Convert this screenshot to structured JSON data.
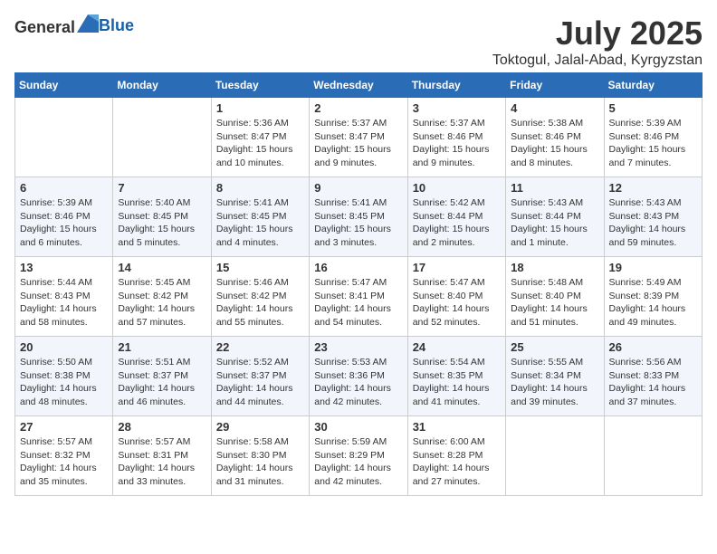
{
  "logo": {
    "general": "General",
    "blue": "Blue"
  },
  "header": {
    "month": "July 2025",
    "location": "Toktogul, Jalal-Abad, Kyrgyzstan"
  },
  "weekdays": [
    "Sunday",
    "Monday",
    "Tuesday",
    "Wednesday",
    "Thursday",
    "Friday",
    "Saturday"
  ],
  "weeks": [
    [
      {
        "day": null
      },
      {
        "day": null
      },
      {
        "day": 1,
        "sunrise": "Sunrise: 5:36 AM",
        "sunset": "Sunset: 8:47 PM",
        "daylight": "Daylight: 15 hours and 10 minutes."
      },
      {
        "day": 2,
        "sunrise": "Sunrise: 5:37 AM",
        "sunset": "Sunset: 8:47 PM",
        "daylight": "Daylight: 15 hours and 9 minutes."
      },
      {
        "day": 3,
        "sunrise": "Sunrise: 5:37 AM",
        "sunset": "Sunset: 8:46 PM",
        "daylight": "Daylight: 15 hours and 9 minutes."
      },
      {
        "day": 4,
        "sunrise": "Sunrise: 5:38 AM",
        "sunset": "Sunset: 8:46 PM",
        "daylight": "Daylight: 15 hours and 8 minutes."
      },
      {
        "day": 5,
        "sunrise": "Sunrise: 5:39 AM",
        "sunset": "Sunset: 8:46 PM",
        "daylight": "Daylight: 15 hours and 7 minutes."
      }
    ],
    [
      {
        "day": 6,
        "sunrise": "Sunrise: 5:39 AM",
        "sunset": "Sunset: 8:46 PM",
        "daylight": "Daylight: 15 hours and 6 minutes."
      },
      {
        "day": 7,
        "sunrise": "Sunrise: 5:40 AM",
        "sunset": "Sunset: 8:45 PM",
        "daylight": "Daylight: 15 hours and 5 minutes."
      },
      {
        "day": 8,
        "sunrise": "Sunrise: 5:41 AM",
        "sunset": "Sunset: 8:45 PM",
        "daylight": "Daylight: 15 hours and 4 minutes."
      },
      {
        "day": 9,
        "sunrise": "Sunrise: 5:41 AM",
        "sunset": "Sunset: 8:45 PM",
        "daylight": "Daylight: 15 hours and 3 minutes."
      },
      {
        "day": 10,
        "sunrise": "Sunrise: 5:42 AM",
        "sunset": "Sunset: 8:44 PM",
        "daylight": "Daylight: 15 hours and 2 minutes."
      },
      {
        "day": 11,
        "sunrise": "Sunrise: 5:43 AM",
        "sunset": "Sunset: 8:44 PM",
        "daylight": "Daylight: 15 hours and 1 minute."
      },
      {
        "day": 12,
        "sunrise": "Sunrise: 5:43 AM",
        "sunset": "Sunset: 8:43 PM",
        "daylight": "Daylight: 14 hours and 59 minutes."
      }
    ],
    [
      {
        "day": 13,
        "sunrise": "Sunrise: 5:44 AM",
        "sunset": "Sunset: 8:43 PM",
        "daylight": "Daylight: 14 hours and 58 minutes."
      },
      {
        "day": 14,
        "sunrise": "Sunrise: 5:45 AM",
        "sunset": "Sunset: 8:42 PM",
        "daylight": "Daylight: 14 hours and 57 minutes."
      },
      {
        "day": 15,
        "sunrise": "Sunrise: 5:46 AM",
        "sunset": "Sunset: 8:42 PM",
        "daylight": "Daylight: 14 hours and 55 minutes."
      },
      {
        "day": 16,
        "sunrise": "Sunrise: 5:47 AM",
        "sunset": "Sunset: 8:41 PM",
        "daylight": "Daylight: 14 hours and 54 minutes."
      },
      {
        "day": 17,
        "sunrise": "Sunrise: 5:47 AM",
        "sunset": "Sunset: 8:40 PM",
        "daylight": "Daylight: 14 hours and 52 minutes."
      },
      {
        "day": 18,
        "sunrise": "Sunrise: 5:48 AM",
        "sunset": "Sunset: 8:40 PM",
        "daylight": "Daylight: 14 hours and 51 minutes."
      },
      {
        "day": 19,
        "sunrise": "Sunrise: 5:49 AM",
        "sunset": "Sunset: 8:39 PM",
        "daylight": "Daylight: 14 hours and 49 minutes."
      }
    ],
    [
      {
        "day": 20,
        "sunrise": "Sunrise: 5:50 AM",
        "sunset": "Sunset: 8:38 PM",
        "daylight": "Daylight: 14 hours and 48 minutes."
      },
      {
        "day": 21,
        "sunrise": "Sunrise: 5:51 AM",
        "sunset": "Sunset: 8:37 PM",
        "daylight": "Daylight: 14 hours and 46 minutes."
      },
      {
        "day": 22,
        "sunrise": "Sunrise: 5:52 AM",
        "sunset": "Sunset: 8:37 PM",
        "daylight": "Daylight: 14 hours and 44 minutes."
      },
      {
        "day": 23,
        "sunrise": "Sunrise: 5:53 AM",
        "sunset": "Sunset: 8:36 PM",
        "daylight": "Daylight: 14 hours and 42 minutes."
      },
      {
        "day": 24,
        "sunrise": "Sunrise: 5:54 AM",
        "sunset": "Sunset: 8:35 PM",
        "daylight": "Daylight: 14 hours and 41 minutes."
      },
      {
        "day": 25,
        "sunrise": "Sunrise: 5:55 AM",
        "sunset": "Sunset: 8:34 PM",
        "daylight": "Daylight: 14 hours and 39 minutes."
      },
      {
        "day": 26,
        "sunrise": "Sunrise: 5:56 AM",
        "sunset": "Sunset: 8:33 PM",
        "daylight": "Daylight: 14 hours and 37 minutes."
      }
    ],
    [
      {
        "day": 27,
        "sunrise": "Sunrise: 5:57 AM",
        "sunset": "Sunset: 8:32 PM",
        "daylight": "Daylight: 14 hours and 35 minutes."
      },
      {
        "day": 28,
        "sunrise": "Sunrise: 5:57 AM",
        "sunset": "Sunset: 8:31 PM",
        "daylight": "Daylight: 14 hours and 33 minutes."
      },
      {
        "day": 29,
        "sunrise": "Sunrise: 5:58 AM",
        "sunset": "Sunset: 8:30 PM",
        "daylight": "Daylight: 14 hours and 31 minutes."
      },
      {
        "day": 30,
        "sunrise": "Sunrise: 5:59 AM",
        "sunset": "Sunset: 8:29 PM",
        "daylight": "Daylight: 14 hours and 42 minutes."
      },
      {
        "day": 31,
        "sunrise": "Sunrise: 6:00 AM",
        "sunset": "Sunset: 8:28 PM",
        "daylight": "Daylight: 14 hours and 27 minutes."
      },
      {
        "day": null
      },
      {
        "day": null
      }
    ]
  ]
}
